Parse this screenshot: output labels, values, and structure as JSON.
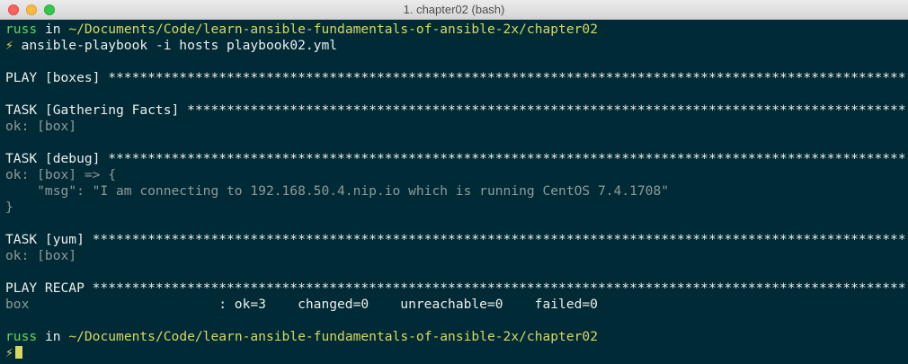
{
  "window": {
    "title": "1. chapter02 (bash)",
    "buttons": {
      "close": "close",
      "minimize": "minimize",
      "zoom": "zoom"
    }
  },
  "colors": {
    "background": "#002b36",
    "prompt_user": "#5fd75f",
    "prompt_path": "#d7d75f",
    "text": "#eeeeee",
    "ok": "#8f9a9a"
  },
  "prompt1": {
    "user": "russ",
    "in": " in ",
    "path": "~/Documents/Code/learn-ansible-fundamentals-of-ansible-2x/chapter02",
    "symbol": "⚡",
    "command": " ansible-playbook -i hosts playbook02.yml"
  },
  "output": {
    "play_header": "PLAY [boxes] *****************************************************************************************************",
    "task1_header": "TASK [Gathering Facts] *******************************************************************************************",
    "task1_result": "ok: [box]",
    "task2_header": "TASK [debug] *****************************************************************************************************",
    "task2_result": "ok: [box] => {",
    "task2_msg": "    \"msg\": \"I am connecting to 192.168.50.4.nip.io which is running CentOS 7.4.1708\"",
    "task2_close": "}",
    "task3_header": "TASK [yum] *******************************************************************************************************",
    "task3_result": "ok: [box]",
    "recap_header": "PLAY RECAP *******************************************************************************************************",
    "recap_host": "box",
    "recap_stats": "                        : ok=3    changed=0    unreachable=0    failed=0"
  },
  "prompt2": {
    "user": "russ",
    "in": " in ",
    "path": "~/Documents/Code/learn-ansible-fundamentals-of-ansible-2x/chapter02",
    "symbol": "⚡"
  }
}
